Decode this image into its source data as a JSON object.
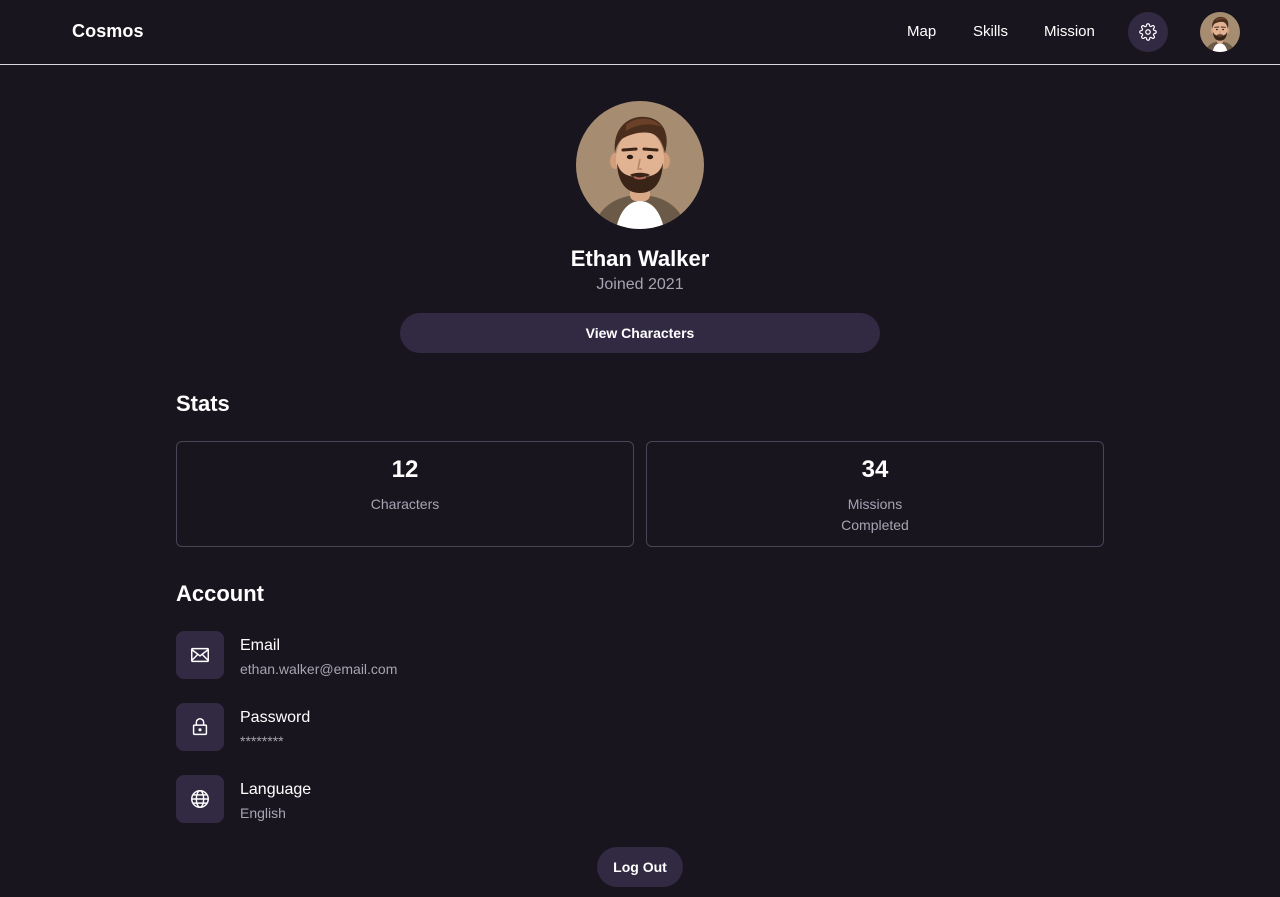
{
  "header": {
    "brand": "Cosmos",
    "nav": {
      "map": "Map",
      "skills": "Skills",
      "mission": "Mission"
    },
    "settings_icon": "gear-icon",
    "avatar_icon": "user-avatar"
  },
  "profile": {
    "name": "Ethan Walker",
    "joined": "Joined 2021",
    "view_button": "View Characters"
  },
  "stats": {
    "title": "Stats",
    "items": [
      {
        "value": "12",
        "label": "Characters"
      },
      {
        "value": "34",
        "label": "Missions Completed"
      }
    ]
  },
  "account": {
    "title": "Account",
    "items": [
      {
        "icon": "mail-icon",
        "label": "Email",
        "value": "ethan.walker@email.com"
      },
      {
        "icon": "lock-icon",
        "label": "Password",
        "value": "********"
      },
      {
        "icon": "globe-icon",
        "label": "Language",
        "value": "English"
      }
    ]
  },
  "logout_label": "Log Out",
  "colors": {
    "background": "#18151f",
    "surface": "#322a42",
    "muted_text": "#a8a3b3",
    "card_border": "#4a4456"
  }
}
